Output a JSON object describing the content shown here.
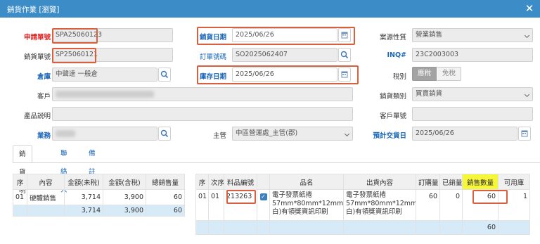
{
  "window": {
    "title": "銷貨作業 [瀏覽]"
  },
  "form": {
    "request_no": {
      "label": "申請單號",
      "value": "SPA25060123"
    },
    "sales_no": {
      "label": "銷貨單號",
      "value": "SP25060121"
    },
    "warehouse": {
      "label": "倉庫",
      "value": "中聲達 一般倉"
    },
    "customer": {
      "label": "客戶"
    },
    "product_desc": {
      "label": "產品説明"
    },
    "salesperson": {
      "label": "業務"
    },
    "sales_date": {
      "label": "銷貨日期",
      "value": "2025/06/26"
    },
    "order_no": {
      "label": "訂單號碼",
      "value": "SO2025062407"
    },
    "stock_date": {
      "label": "庫存日期",
      "value": "2025/06/26"
    },
    "supervisor": {
      "label": "主管",
      "value": "中區營運處_主管(郡)"
    },
    "source_type": {
      "label": "案源性質",
      "value": "營業銷售"
    },
    "inq": {
      "label": "INQ#",
      "value": "23C2003003"
    },
    "tax": {
      "label": "稅別",
      "options": [
        "應稅",
        "免稅"
      ],
      "selected": "應稅"
    },
    "sales_category": {
      "label": "銷貨類別",
      "value": "買賣銷貨"
    },
    "customer_no": {
      "label": "客戶單號"
    },
    "expected_date": {
      "label": "預計交貨日",
      "value": "2025/06/26"
    }
  },
  "tabs": [
    "銷貨明細",
    "聯絡人",
    "備註"
  ],
  "left_table": {
    "headers": [
      "序",
      "內容",
      "金額(未稅)",
      "金額(含稅)",
      "總銷售量"
    ],
    "rows": [
      [
        "01",
        "硬體銷售",
        "3,714",
        "3,900",
        "60"
      ]
    ],
    "totals": [
      "",
      "",
      "3,714",
      "3,900",
      "60"
    ]
  },
  "right_table": {
    "headers": [
      "序",
      "次序",
      "料品編號",
      "",
      "品名",
      "出貨內容",
      "訂購量",
      "已銷量",
      "銷售數量",
      "可用庫"
    ],
    "rows": [
      {
        "seq": "01",
        "order": "01",
        "item_no": "213263",
        "name_lines": [
          "電子發票紙捲",
          "57mm*80mm*12mm(空",
          "白)有領獎資訊印刷"
        ],
        "content_lines": [
          "電子發票紙捲",
          "57mm*80mm*12mm(空",
          "白)有領獎資訊印刷"
        ],
        "ordered": "60",
        "sold": "0",
        "qty": "60",
        "available": "1"
      }
    ],
    "total_qty": "60"
  },
  "colors": {
    "titlebar": "#3c8dc7",
    "highlight_box": "#d9603e",
    "required_label": "#e02a2a",
    "link_label": "#1a67b9",
    "qty_header": "#f7f73a",
    "selected_row": "#d6ebf7"
  },
  "icons": {
    "close": "close-icon",
    "search": "search-icon",
    "calendar": "calendar-icon",
    "checkbox": "checkbox-icon"
  }
}
